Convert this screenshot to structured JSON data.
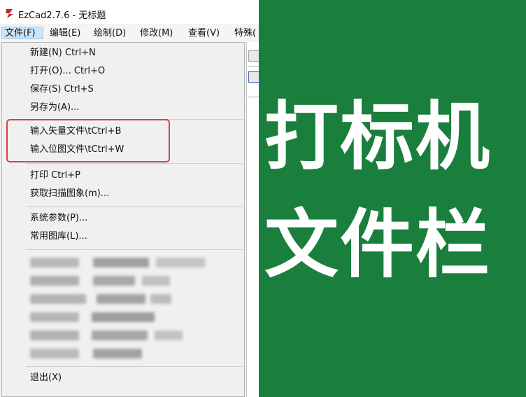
{
  "window": {
    "title": "EzCad2.7.6 - 无标题"
  },
  "menubar": {
    "items": [
      "文件(F)",
      "编辑(E)",
      "绘制(D)",
      "修改(M)",
      "查看(V)",
      "特殊("
    ]
  },
  "file_menu": {
    "new": "新建(N) Ctrl+N",
    "open": "打开(O)... Ctrl+O",
    "save": "保存(S) Ctrl+S",
    "save_as": "另存为(A)...",
    "import_vector": "输入矢量文件\\tCtrl+B",
    "import_bitmap": "输入位图文件\\tCtrl+W",
    "print": "打印 Ctrl+P",
    "acquire_scan": "获取扫描图象(m)...",
    "system_params": "系统参数(P)...",
    "common_library": "常用图库(L)...",
    "exit": "退出(X)"
  },
  "overlay": {
    "line1": "打标机",
    "line2": "文件栏"
  },
  "colors": {
    "background_green": "#1a7f3c",
    "highlight_red": "#e23b3b",
    "menu_selected": "#cce4f7"
  }
}
